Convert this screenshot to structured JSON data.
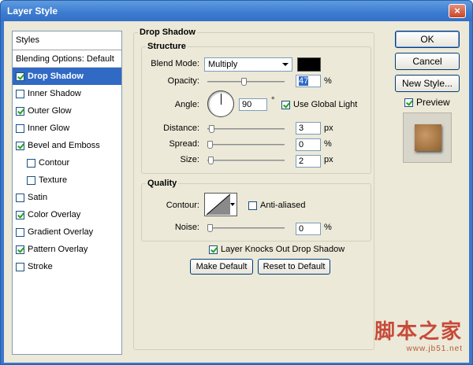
{
  "window": {
    "title": "Layer Style",
    "close_glyph": "×"
  },
  "styles": {
    "header": "Styles",
    "blending": "Blending Options: Default",
    "items": [
      {
        "label": "Drop Shadow",
        "checked": true,
        "selected": true,
        "indent": false
      },
      {
        "label": "Inner Shadow",
        "checked": false,
        "selected": false,
        "indent": false
      },
      {
        "label": "Outer Glow",
        "checked": true,
        "selected": false,
        "indent": false
      },
      {
        "label": "Inner Glow",
        "checked": false,
        "selected": false,
        "indent": false
      },
      {
        "label": "Bevel and Emboss",
        "checked": true,
        "selected": false,
        "indent": false
      },
      {
        "label": "Contour",
        "checked": false,
        "selected": false,
        "indent": true
      },
      {
        "label": "Texture",
        "checked": false,
        "selected": false,
        "indent": true
      },
      {
        "label": "Satin",
        "checked": false,
        "selected": false,
        "indent": false
      },
      {
        "label": "Color Overlay",
        "checked": true,
        "selected": false,
        "indent": false
      },
      {
        "label": "Gradient Overlay",
        "checked": false,
        "selected": false,
        "indent": false
      },
      {
        "label": "Pattern Overlay",
        "checked": true,
        "selected": false,
        "indent": false
      },
      {
        "label": "Stroke",
        "checked": false,
        "selected": false,
        "indent": false
      }
    ]
  },
  "drop_shadow": {
    "section_title": "Drop Shadow",
    "structure": {
      "title": "Structure",
      "blend_mode_label": "Blend Mode:",
      "blend_mode_value": "Multiply",
      "shadow_color": "#000000",
      "opacity_label": "Opacity:",
      "opacity_value": "47",
      "opacity_fraction": 0.47,
      "opacity_unit": "%",
      "angle_label": "Angle:",
      "angle_value": "90",
      "angle_unit": "°",
      "use_global_light": "Use Global Light",
      "use_global_light_checked": true,
      "distance_label": "Distance:",
      "distance_value": "3",
      "distance_unit": "px",
      "spread_label": "Spread:",
      "spread_value": "0",
      "spread_unit": "%",
      "size_label": "Size:",
      "size_value": "2",
      "size_unit": "px"
    },
    "quality": {
      "title": "Quality",
      "contour_label": "Contour:",
      "anti_aliased": "Anti-aliased",
      "anti_aliased_checked": false,
      "noise_label": "Noise:",
      "noise_value": "0",
      "noise_unit": "%"
    },
    "knockout": "Layer Knocks Out Drop Shadow",
    "knockout_checked": true,
    "make_default": "Make Default",
    "reset_default": "Reset to Default"
  },
  "actions": {
    "ok": "OK",
    "cancel": "Cancel",
    "new_style": "New Style...",
    "preview": "Preview",
    "preview_checked": true
  },
  "watermark": {
    "cn": "脚本之家",
    "url": "www.jb51.net"
  }
}
